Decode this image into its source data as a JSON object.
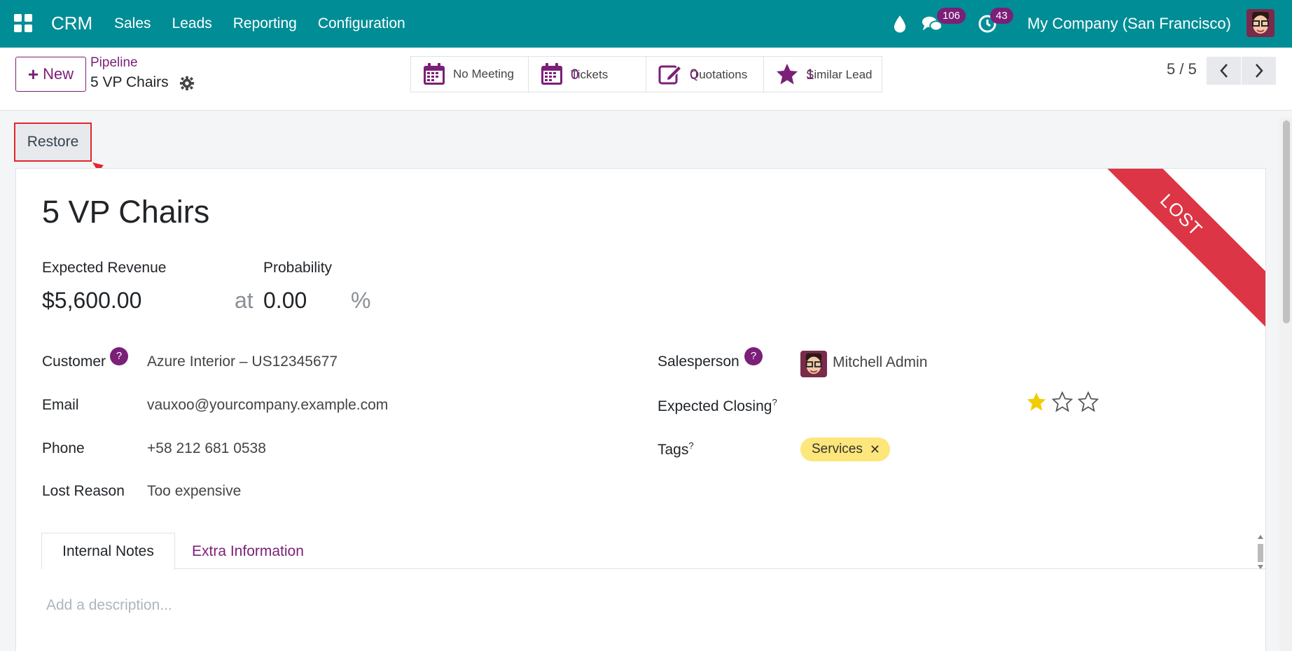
{
  "navbar": {
    "brand": "CRM",
    "menu": [
      "Sales",
      "Leads",
      "Reporting",
      "Configuration"
    ],
    "messages_badge": "106",
    "activities_badge": "43",
    "company": "My Company (San Francisco)"
  },
  "control": {
    "new_label": "New",
    "breadcrumb_parent": "Pipeline",
    "breadcrumb_current": "5 VP Chairs",
    "smart_buttons": [
      {
        "label": "No Meeting",
        "value": ""
      },
      {
        "label": "Tickets",
        "value": "0"
      },
      {
        "label": "Quotations",
        "value": "0"
      },
      {
        "label": "Similar Lead",
        "value": "1"
      }
    ],
    "pager": "5 / 5"
  },
  "restore_label": "Restore",
  "ribbon": "LOST",
  "form": {
    "title": "5 VP Chairs",
    "expected_revenue_label": "Expected Revenue",
    "probability_label": "Probability",
    "expected_revenue": "$5,600.00",
    "at": "at",
    "probability": "0.00",
    "percent": "%",
    "customer_label": "Customer",
    "customer": "Azure Interior – US12345677",
    "email_label": "Email",
    "email": "vauxoo@yourcompany.example.com",
    "phone_label": "Phone",
    "phone": "+58 212 681 0538",
    "lost_reason_label": "Lost Reason",
    "lost_reason": "Too expensive",
    "salesperson_label": "Salesperson",
    "salesperson": "Mitchell Admin",
    "expected_closing_label": "Expected Closing",
    "tags_label": "Tags",
    "tag": "Services",
    "priority_stars": 1,
    "help_mark": "?"
  },
  "tabs": {
    "internal_notes": "Internal Notes",
    "extra_information": "Extra Information"
  },
  "description_placeholder": "Add a description...",
  "colors": {
    "navbar": "#018d96",
    "accent": "#7b1f78",
    "lost": "#dc3545",
    "tag": "#fde67a",
    "star": "#f3cc00"
  }
}
